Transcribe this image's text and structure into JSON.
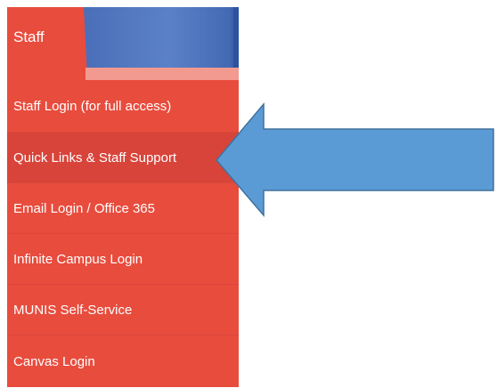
{
  "sidebar": {
    "header_title": "Staff",
    "items": [
      {
        "label": "Staff Login (for full access)"
      },
      {
        "label": "Quick Links & Staff Support"
      },
      {
        "label": "Email Login / Office 365"
      },
      {
        "label": "Infinite Campus Login"
      },
      {
        "label": "MUNIS Self-Service"
      },
      {
        "label": "Canvas Login"
      }
    ]
  },
  "annotation": {
    "arrow_icon": "left-arrow-icon",
    "arrow_color": "#5b9bd5",
    "arrow_border_color": "#41719c"
  },
  "colors": {
    "menu_red": "#e84c3d",
    "header_blue": "#4a6fb8"
  }
}
